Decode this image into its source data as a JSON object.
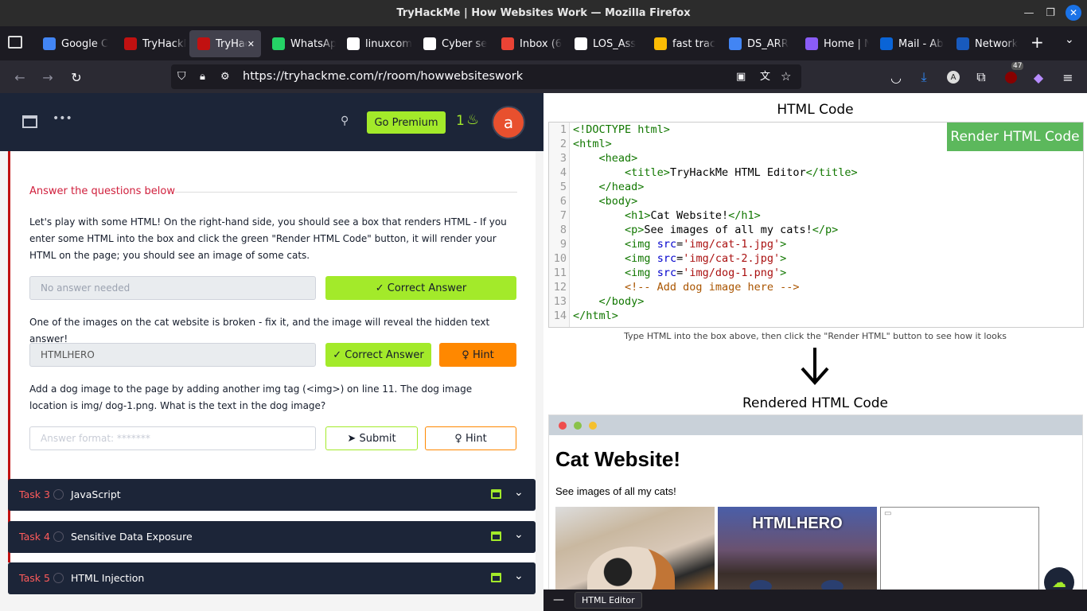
{
  "window": {
    "title": "TryHackMe | How Websites Work — Mozilla Firefox"
  },
  "tabs": [
    {
      "label": "Google C",
      "icon": "google-icon",
      "color": "#4285f4"
    },
    {
      "label": "TryHackM",
      "icon": "tryhackme-icon",
      "color": "#c11111"
    },
    {
      "label": "TryHac",
      "icon": "tryhackme-icon",
      "color": "#c11111",
      "active": true
    },
    {
      "label": "WhatsAp",
      "icon": "whatsapp-icon",
      "color": "#25d366"
    },
    {
      "label": "linuxcom",
      "icon": "github-icon",
      "color": "#ffffff"
    },
    {
      "label": "Cyber se",
      "icon": "notion-icon",
      "color": "#ffffff"
    },
    {
      "label": "Inbox (6",
      "icon": "gmail-icon",
      "color": "#ea4335"
    },
    {
      "label": "LOS_Ass",
      "icon": "github-icon",
      "color": "#ffffff"
    },
    {
      "label": "fast trac",
      "icon": "drive-icon",
      "color": "#fbbc04"
    },
    {
      "label": "DS_ARR",
      "icon": "docs-icon",
      "color": "#4285f4"
    },
    {
      "label": "Home | N",
      "icon": "home-icon",
      "color": "#8a5cf6"
    },
    {
      "label": "Mail - Ab",
      "icon": "outlook-icon",
      "color": "#0a64d6"
    },
    {
      "label": "Network",
      "icon": "word-icon",
      "color": "#185abd"
    }
  ],
  "nav": {
    "url": "https://tryhackme.com/r/room/howwebsiteswork",
    "badge": "47"
  },
  "thm": {
    "premium": "Go Premium",
    "streak": "1",
    "avatar": "a"
  },
  "questions": {
    "heading": "Answer the questions below",
    "q1": "Let's play with some HTML! On the right-hand side, you should see a box that renders HTML - If you enter some HTML into the box and click the green \"Render HTML Code\" button, it will render your HTML on the page; you should see an image of some cats.",
    "a1": "No answer needed",
    "correct": "✓ Correct Answer",
    "q2": "One of the images on the cat website is broken - fix it, and the image will reveal the hidden text answer!",
    "a2": "HTMLHERO",
    "hint": "♀ Hint",
    "q3": "Add a dog image to the page by adding another img tag (<img>) on line 11. The dog image location is img/ dog-1.png. What is the text in the dog image?",
    "a3_placeholder": "Answer format: *******",
    "submit": "➤ Submit"
  },
  "tasks": [
    {
      "num": "Task 3",
      "name": "JavaScript"
    },
    {
      "num": "Task 4",
      "name": "Sensitive Data Exposure"
    },
    {
      "num": "Task 5",
      "name": "HTML Injection"
    }
  ],
  "editor": {
    "title": "HTML Code",
    "render_btn": "Render HTML Code",
    "instructions": "Type HTML into the box above, then click the \"Render HTML\" button to see how it looks",
    "rendered_title": "Rendered HTML Code",
    "lines": [
      "1",
      "2",
      "3",
      "4",
      "5",
      "6",
      "7",
      "8",
      "9",
      "10",
      "11",
      "12",
      "13",
      "14"
    ]
  },
  "rendered": {
    "h1": "Cat Website!",
    "p": "See images of all my cats!",
    "img_text": "HTMLHERO"
  },
  "statusbar": {
    "label": "HTML Editor"
  }
}
